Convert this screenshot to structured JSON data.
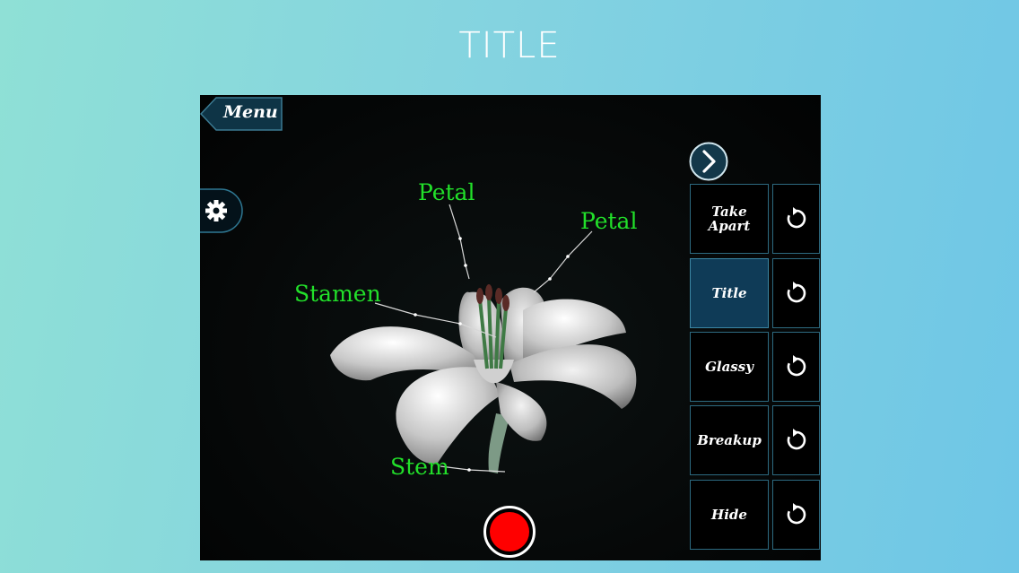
{
  "page": {
    "title": "TITLE"
  },
  "app": {
    "menu_label": "Menu",
    "labels": {
      "petal_top": "Petal",
      "petal_right": "Petal",
      "stamen": "Stamen",
      "stem": "Stem"
    },
    "actions": [
      {
        "label": "Take Apart",
        "active": false
      },
      {
        "label": "Title",
        "active": true
      },
      {
        "label": "Glassy",
        "active": false
      },
      {
        "label": "Breakup",
        "active": false
      },
      {
        "label": "Hide",
        "active": false
      }
    ],
    "icons": {
      "settings": "gear-icon",
      "next": "chevron-right-icon",
      "reset": "reset-icon",
      "record": "record-icon"
    },
    "colors": {
      "label_green": "#22e02a",
      "active_button": "#0f3b57",
      "button_border": "#2d6a80",
      "record_red": "#ff0000"
    }
  }
}
